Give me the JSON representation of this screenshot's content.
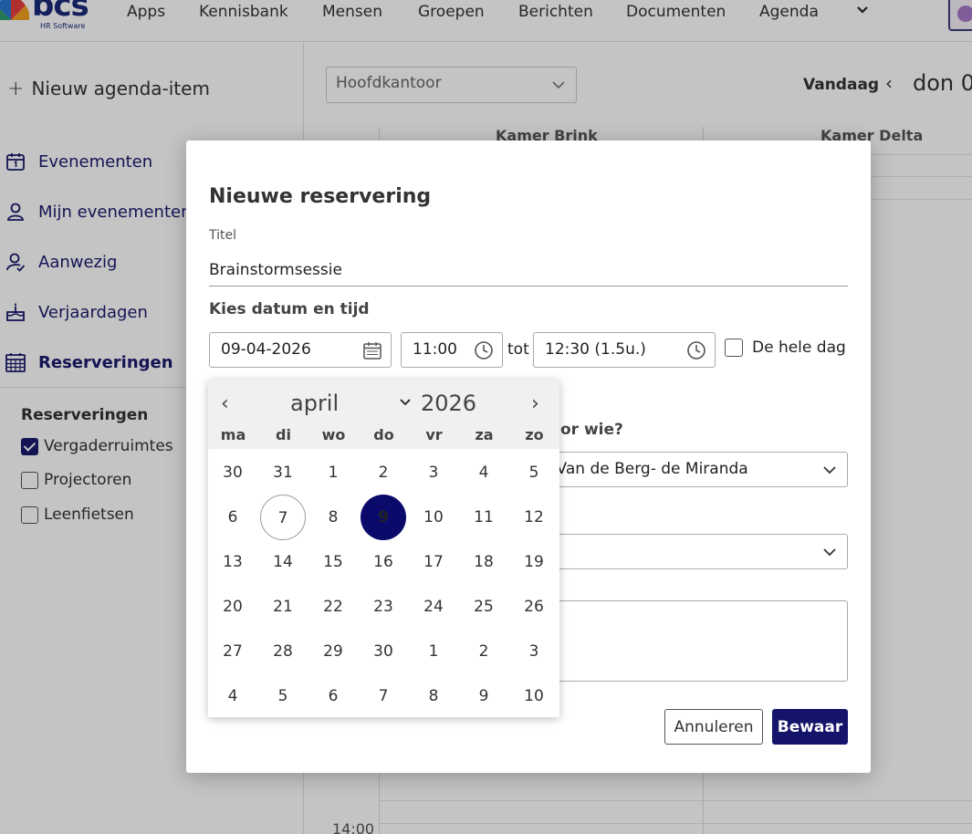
{
  "nav": {
    "logo_text": "bcs",
    "logo_sub": "HR Software",
    "items": [
      "Apps",
      "Kennisbank",
      "Mensen",
      "Groepen",
      "Berichten",
      "Documenten",
      "Agenda"
    ]
  },
  "sidebar": {
    "new_item": "Nieuw agenda-item",
    "links": [
      "Evenementen",
      "Mijn evenementen",
      "Aanwezig",
      "Verjaardagen",
      "Reserveringen"
    ],
    "active": "Reserveringen",
    "section_title": "Reserveringen",
    "checks": [
      {
        "label": "Vergaderruimtes",
        "checked": true
      },
      {
        "label": "Projectoren",
        "checked": false
      },
      {
        "label": "Leenfietsen",
        "checked": false
      }
    ]
  },
  "main": {
    "location": "Hoofdkantoor",
    "today": "Vandaag",
    "date_label": "don 0",
    "columns": [
      "Kamer Brink",
      "Kamer Delta"
    ],
    "time_label": "14:00"
  },
  "modal": {
    "title": "Nieuwe reservering",
    "title_label": "Titel",
    "title_value": "Brainstormsessie",
    "datetime_label": "Kies datum en tijd",
    "date_value": "09-04-2026",
    "start_time": "11:00",
    "tot": "tot",
    "end_time": "12:30 (1.5u.)",
    "all_day": "De hele dag",
    "for_who_label": "or wie?",
    "for_who_value": "ophie Van de Berg- de Miranda",
    "cancel": "Annuleren",
    "save": "Bewaar"
  },
  "datepicker": {
    "month": "april",
    "year": "2026",
    "weekdays": [
      "ma",
      "di",
      "wo",
      "do",
      "vr",
      "za",
      "zo"
    ],
    "weeks": [
      [
        "30",
        "31",
        "1",
        "2",
        "3",
        "4",
        "5"
      ],
      [
        "6",
        "7",
        "8",
        "9",
        "10",
        "11",
        "12"
      ],
      [
        "13",
        "14",
        "15",
        "16",
        "17",
        "18",
        "19"
      ],
      [
        "20",
        "21",
        "22",
        "23",
        "24",
        "25",
        "26"
      ],
      [
        "27",
        "28",
        "29",
        "30",
        "1",
        "2",
        "3"
      ],
      [
        "4",
        "5",
        "6",
        "7",
        "8",
        "9",
        "10"
      ]
    ],
    "today": "7",
    "selected": "9"
  },
  "colors": {
    "brand": "#14146b",
    "nav_text": "#1a1a6e"
  }
}
